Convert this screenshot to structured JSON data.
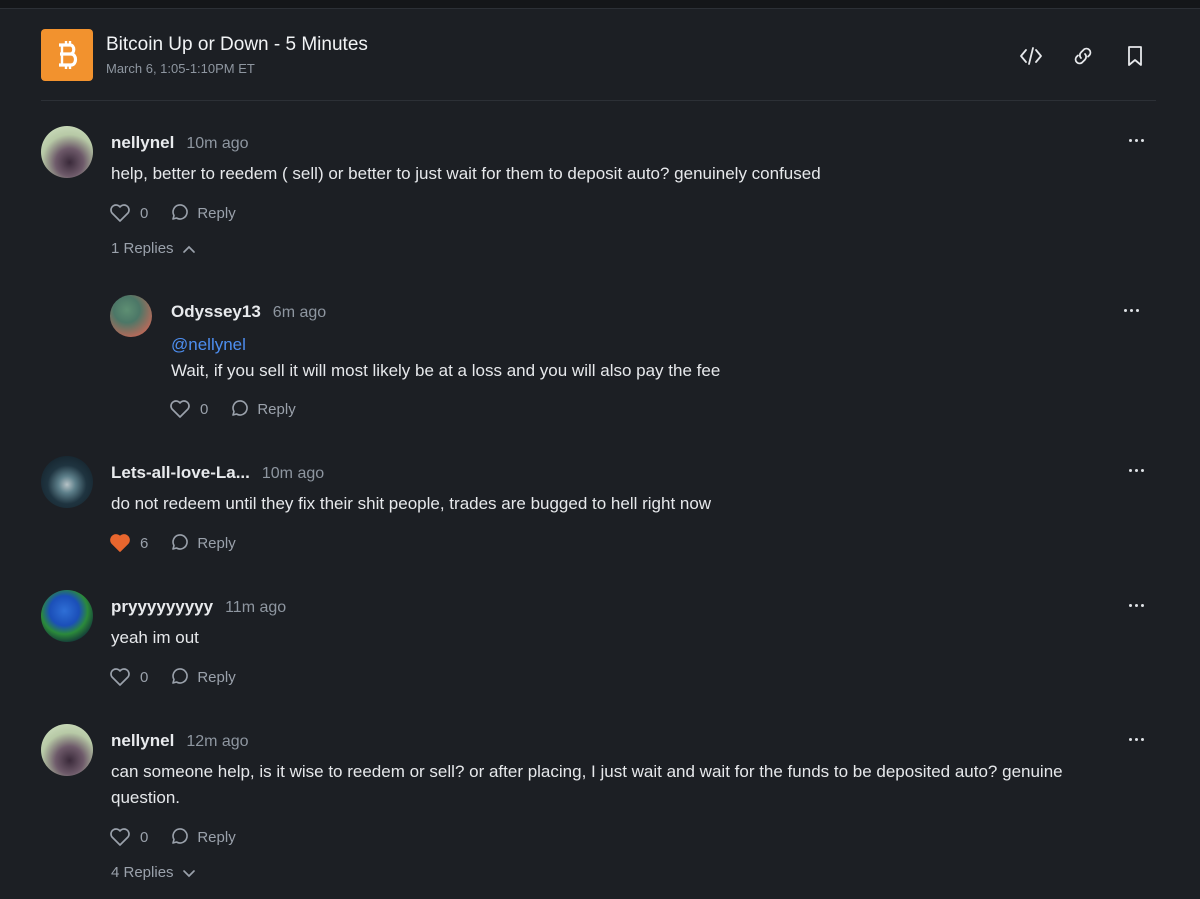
{
  "market": {
    "title": "Bitcoin Up or Down - 5 Minutes",
    "date": "March 6, 1:05-1:10PM ET",
    "icon": "bitcoin-icon",
    "accent": "#f2922e"
  },
  "header_actions": [
    {
      "icon": "embed-code-icon"
    },
    {
      "icon": "link-icon"
    },
    {
      "icon": "bookmark-icon"
    }
  ],
  "comments": [
    {
      "user": "nellynel",
      "time": "10m ago",
      "text": "help, better to reedem ( sell) or better to just wait for them to deposit auto? genuinely confused",
      "likes": "0",
      "reply_label": "Reply",
      "replies_label": "1 Replies",
      "replies_expanded": true
    },
    {
      "user": "Odyssey13",
      "time": "6m ago",
      "mention": "@nellynel",
      "text": "Wait, if you sell it will most likely be at a loss and you will also pay the fee",
      "likes": "0",
      "reply_label": "Reply"
    },
    {
      "user": "Lets-all-love-La...",
      "time": "10m ago",
      "text": "do not redeem until they fix their shit people, trades are bugged to hell right now",
      "likes": "6",
      "liked": true,
      "reply_label": "Reply"
    },
    {
      "user": "pryyyyyyyyy",
      "time": "11m ago",
      "text": "yeah im out",
      "likes": "0",
      "reply_label": "Reply"
    },
    {
      "user": "nellynel",
      "time": "12m ago",
      "text": "can someone help, is it wise to reedem or sell? or after placing, I just wait and wait for the funds to be deposited auto? genuine question.",
      "likes": "0",
      "reply_label": "Reply",
      "replies_label": "4 Replies",
      "replies_expanded": false
    }
  ],
  "colors": {
    "background": "#1c1f24",
    "liked_heart": "#e8662e",
    "mention": "#4d8ef0"
  }
}
